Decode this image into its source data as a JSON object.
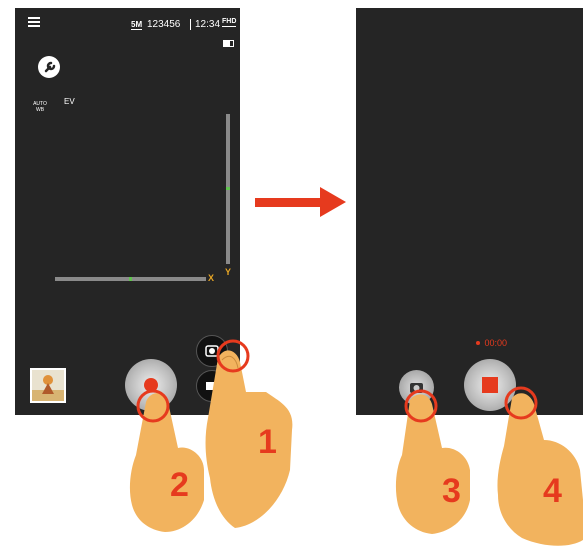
{
  "left_screen": {
    "status_bar": {
      "resolution": "5M",
      "shots_remaining": "123456",
      "time": "12:34",
      "video_quality": "FHD"
    },
    "settings_icon": "wrench-icon",
    "auto_wb": {
      "line1": "AUTO",
      "line2": "WB"
    },
    "ev_label": "EV",
    "axis_y_label": "Y",
    "axis_x_label": "X",
    "gallery_thumbnail": "photo-thumbnail",
    "mode_buttons": [
      "camera-mode-icon",
      "video-mode-icon"
    ]
  },
  "right_screen": {
    "rec_time": "00:00",
    "stop_icon": "stop-square-icon",
    "snapshot_icon": "camera-icon"
  },
  "arrow": "right-arrow-icon",
  "steps": [
    "1",
    "2",
    "3",
    "4"
  ],
  "colors": {
    "screen_bg": "#252525",
    "accent_red": "#e63a1e",
    "axis_yellow": "#e8a624",
    "hand": "#f2b35e"
  }
}
